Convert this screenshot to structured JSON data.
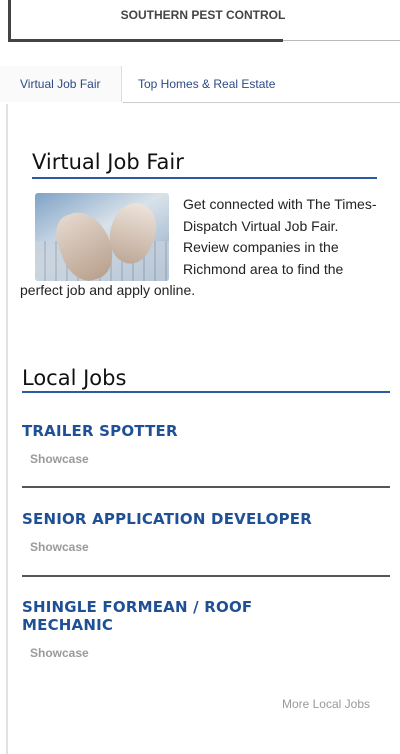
{
  "ad": {
    "title": "SOUTHERN PEST CONTROL"
  },
  "tabs": [
    {
      "label": "Virtual Job Fair"
    },
    {
      "label": "Top Homes & Real Estate"
    }
  ],
  "virtual_job_fair": {
    "heading": "Virtual Job Fair",
    "body": "Get connected with The Times-Dispatch Virtual Job Fair. Review companies in the Richmond area to find the perfect job and apply online."
  },
  "local_jobs": {
    "heading": "Local Jobs",
    "jobs": [
      {
        "title": "TRAILER SPOTTER",
        "tag": "Showcase"
      },
      {
        "title": "SENIOR APPLICATION DEVELOPER",
        "tag": "Showcase"
      },
      {
        "title": "SHINGLE FORMEAN / ROOF MECHANIC",
        "tag": "Showcase"
      }
    ],
    "more_label": "More Local Jobs"
  },
  "colors": {
    "accent": "#2a5aa6",
    "job_title": "#1f4f95",
    "tab_text": "#2c4a86"
  }
}
